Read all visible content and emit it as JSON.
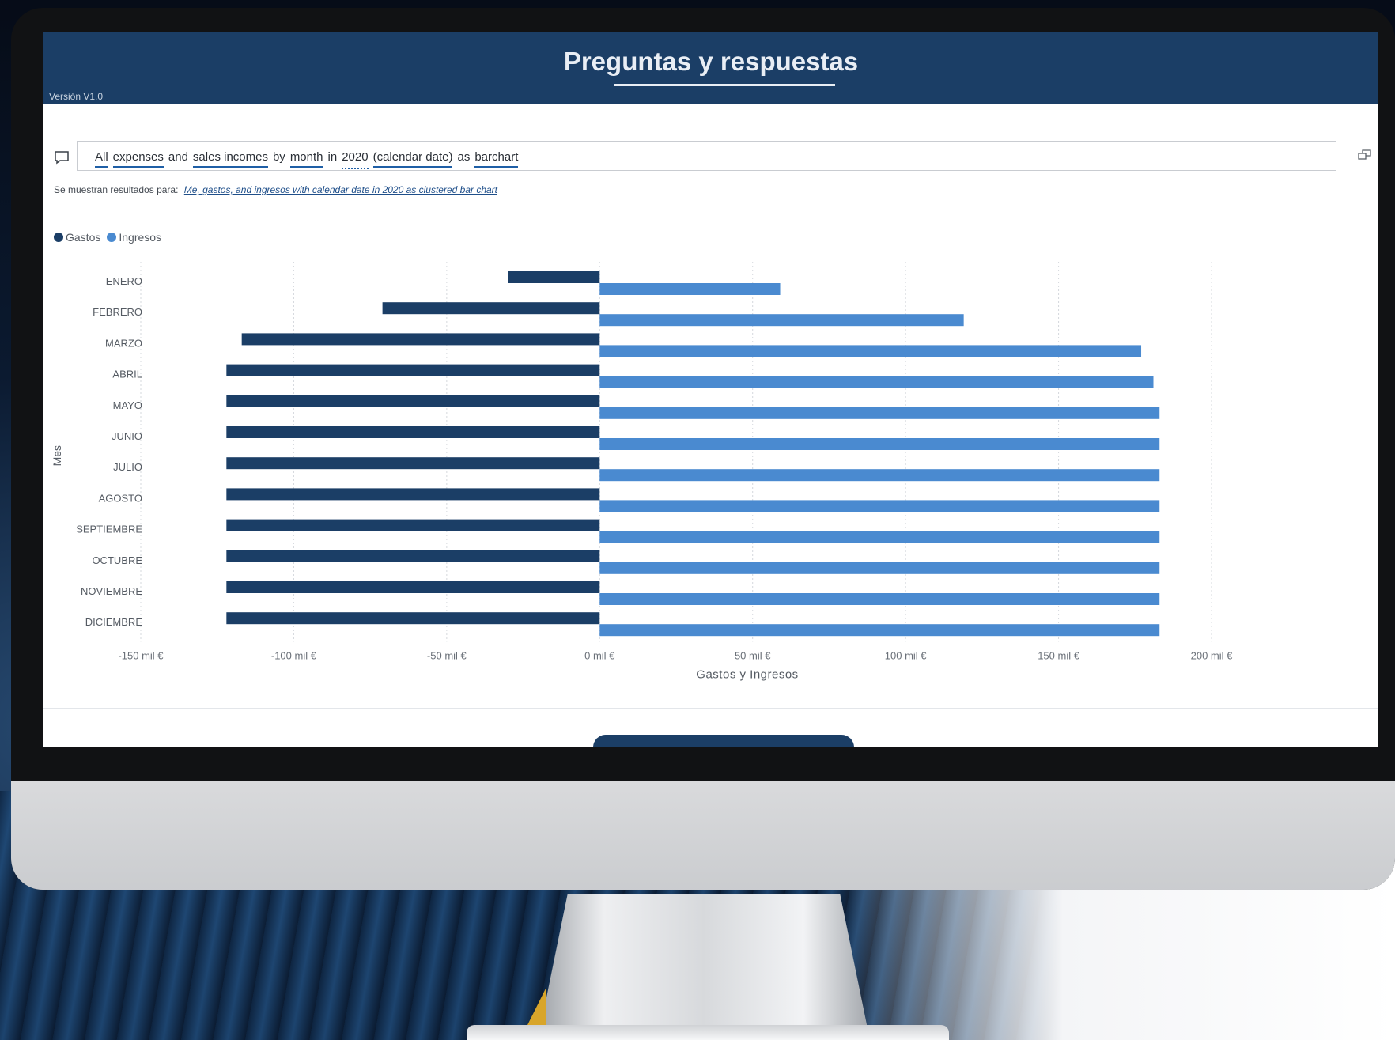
{
  "header": {
    "title": "Preguntas y respuestas",
    "version": "Versión V1.0"
  },
  "qa": {
    "query_words": [
      {
        "text": "All",
        "style": "u"
      },
      {
        "text": "expenses",
        "style": "u"
      },
      {
        "text": "and",
        "style": "plain"
      },
      {
        "text": "sales incomes",
        "style": "u"
      },
      {
        "text": "by",
        "style": "plain"
      },
      {
        "text": "month",
        "style": "u"
      },
      {
        "text": "in",
        "style": "plain"
      },
      {
        "text": "2020",
        "style": "d"
      },
      {
        "text": "(calendar date)",
        "style": "u"
      },
      {
        "text": "as",
        "style": "plain"
      },
      {
        "text": "barchart",
        "style": "u"
      }
    ],
    "results_prefix": "Se muestran resultados para:",
    "results_link": "Me, gastos, and ingresos with calendar date in 2020 as clustered bar chart"
  },
  "legend": [
    {
      "name": "Gastos",
      "color": "#1b3e66"
    },
    {
      "name": "Ingresos",
      "color": "#4a8ad0"
    }
  ],
  "chart_data": {
    "type": "bar",
    "orientation": "horizontal",
    "categories": [
      "ENERO",
      "FEBRERO",
      "MARZO",
      "ABRIL",
      "MAYO",
      "JUNIO",
      "JULIO",
      "AGOSTO",
      "SEPTIEMBRE",
      "OCTUBRE",
      "NOVIEMBRE",
      "DICIEMBRE"
    ],
    "series": [
      {
        "name": "Gastos",
        "color": "#1b3e66",
        "values": [
          -30,
          -71,
          -117,
          -122,
          -122,
          -122,
          -122,
          -122,
          -122,
          -122,
          -122,
          -122
        ]
      },
      {
        "name": "Ingresos",
        "color": "#4a8ad0",
        "values": [
          59,
          119,
          177,
          181,
          183,
          183,
          183,
          183,
          183,
          183,
          183,
          183
        ]
      }
    ],
    "xlabel": "Gastos y Ingresos",
    "ylabel": "Mes",
    "xlim": [
      -150,
      200
    ],
    "xticks": [
      -150,
      -100,
      -50,
      0,
      50,
      100,
      150,
      200
    ],
    "xtick_labels": [
      "-150 mil €",
      "-100 mil €",
      "-50 mil €",
      "0 mil €",
      "50 mil €",
      "100 mil €",
      "150 mil €",
      "200 mil €"
    ],
    "grid": true,
    "legend_position": "top-left"
  }
}
